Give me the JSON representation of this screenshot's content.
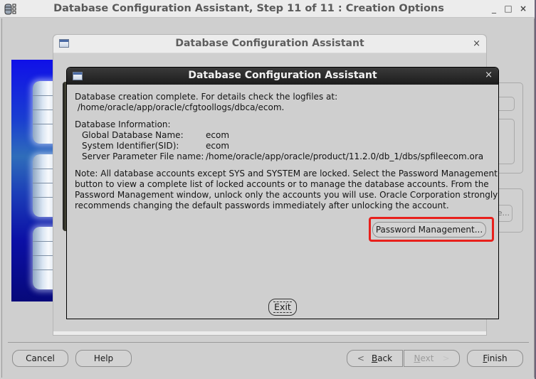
{
  "main_window": {
    "title": "Database Configuration Assistant, Step 11 of 11 : Creation Options",
    "controls": {
      "minimize": "_",
      "maximize": "□",
      "close": "×"
    },
    "app_icon": "database-app-icon"
  },
  "background_dialog": {
    "title": "Database Configuration Assistant",
    "close": "×",
    "ghost_button_text": "e..."
  },
  "completion_dialog": {
    "title": "Database Configuration Assistant",
    "close": "×",
    "line1": "Database creation complete. For details check the logfiles at:",
    "line2": " /home/oracle/app/oracle/cfgtoollogs/dbca/ecom.",
    "info_heading": "Database Information:",
    "info": [
      {
        "label": "Global Database Name:",
        "value": "ecom"
      },
      {
        "label": "System Identifier(SID):",
        "value": "ecom"
      },
      {
        "label": "Server Parameter File name:",
        "value": "/home/oracle/app/oracle/product/11.2.0/db_1/dbs/spfileecom.ora"
      }
    ],
    "note_lines": [
      "Note: All database accounts except SYS and SYSTEM are locked. Select the Password Management",
      "button to view a complete list of locked accounts or to manage the database accounts. From the",
      "Password Management window, unlock only the accounts you will use. Oracle Corporation strongly",
      "recommends changing the default passwords immediately after unlocking the account."
    ],
    "password_management_button": "Password Management...",
    "exit_button": "Exit",
    "highlight_color": "#e8201c"
  },
  "nav": {
    "cancel": "Cancel",
    "help": "Help",
    "back_arrow": "<",
    "back_mnemonic": "B",
    "back_rest": "ack",
    "next_mnemonic": "N",
    "next_rest": "ext",
    "next_arrow": ">",
    "finish_mnemonic": "F",
    "finish_rest": "inish"
  }
}
